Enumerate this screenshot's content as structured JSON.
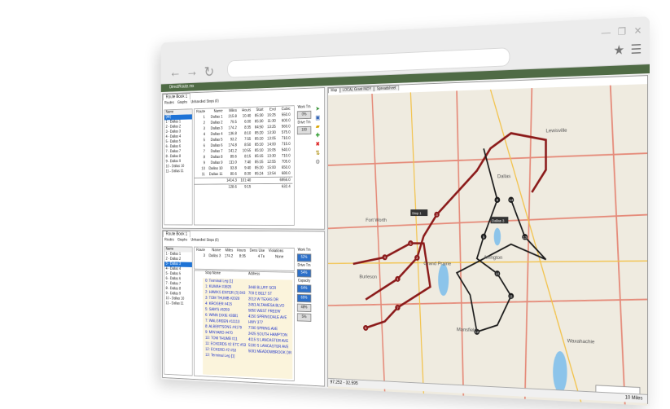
{
  "browser": {
    "back_icon": "arrow-left",
    "forward_icon": "arrow-right",
    "reload_icon": "reload",
    "star_icon": "star",
    "menu_icon": "hamburger"
  },
  "app": {
    "title": "DirectRoute.mx",
    "top_panel": {
      "tab": "Route Book 1",
      "subtabs": [
        "Routes",
        "Graphs",
        "Unhandled Stops (0)"
      ],
      "tree_header": "Name",
      "tree": [
        "(All)",
        "1 - Dallas 1",
        "2 - Dallas 2",
        "3 - Dallas 3",
        "4 - Dallas 4",
        "5 - Dallas 5",
        "6 - Dallas 6",
        "7 - Dallas 7",
        "8 - Dallas 8",
        "9 - Dallas 9",
        "10 - Dallas 10",
        "11 - Dallas 11"
      ],
      "columns": [
        "Route",
        "Name",
        "Miles",
        "Hours",
        "Start",
        "End",
        "Cubic"
      ],
      "rows": [
        [
          "1",
          "Dallas 1",
          "215.8",
          "10.40",
          "05:30",
          "16:25",
          "550.0"
        ],
        [
          "2",
          "Dallas 2",
          "79.5",
          "6:00",
          "05:30",
          "11:30",
          "600.0"
        ],
        [
          "3",
          "Dallas 3",
          "174.2",
          "8:35",
          "04:50",
          "13:25",
          "560.0"
        ],
        [
          "4",
          "Dallas 4",
          "136.8",
          "8:10",
          "05:20",
          "13:30",
          "575.0"
        ],
        [
          "5",
          "Dallas 5",
          "93.2",
          "7:55",
          "05:10",
          "13:05",
          "710.0"
        ],
        [
          "6",
          "Dallas 6",
          "174.8",
          "8:50",
          "05:10",
          "14:00",
          "715.0"
        ],
        [
          "7",
          "Dallas 7",
          "141.2",
          "10:55",
          "05:10",
          "16:05",
          "540.0"
        ],
        [
          "8",
          "Dallas 8",
          "89.6",
          "8:15",
          "05:15",
          "13:30",
          "710.0"
        ],
        [
          "9",
          "Dallas 9",
          "111.0",
          "7:40",
          "05:15",
          "12:55",
          "705.0"
        ],
        [
          "10",
          "Dallas 10",
          "93.8",
          "9:40",
          "05:20",
          "15:00",
          "650.0"
        ],
        [
          "11",
          "Dallas 11",
          "80.6",
          "8:30",
          "05:24",
          "13:54",
          "680.0"
        ]
      ],
      "totals": [
        "1414.3",
        "101:40",
        "",
        "",
        "6956.0"
      ],
      "avg": [
        "128.6",
        "9:15",
        "",
        "",
        "632.4"
      ],
      "side": {
        "work_label": "Work Tm",
        "work_value": "0%",
        "drive_label": "Drive Tm",
        "drive_value": "100"
      }
    },
    "bottom_panel": {
      "tab": "Route Book 1",
      "subtabs": [
        "Routes",
        "Graphs",
        "Unhandled Stops (0)"
      ],
      "search": "3 - Dallas 3",
      "tree_header": "Name",
      "tree": [
        "1 - Dallas 1",
        "2 - Dallas 2",
        "3 - Dallas 3",
        "4 - Dallas 4",
        "5 - Dallas 5",
        "6 - Dallas 6",
        "7 - Dallas 7",
        "8 - Dallas 8",
        "9 - Dallas 9",
        "10 - Dallas 10",
        "11 - Dallas 11"
      ],
      "summary_cols": [
        "Route",
        "Name",
        "Miles",
        "Hours",
        "Dens Use",
        "Violations"
      ],
      "summary_row": [
        "3",
        "Dallas 3",
        "174.2",
        "8:35",
        "4 Tn",
        "None"
      ],
      "stop_cols": [
        "Stop Name",
        "Address"
      ],
      "stops": [
        [
          "0: Terminal Leg [1]",
          ""
        ],
        [
          "1: KUMAH #3826",
          "3448 BLUFF SCR"
        ],
        [
          "2: HAWKS ENTER (3) 8#3",
          "700 E BELT ST"
        ],
        [
          "3: TOM THUMB #2020",
          "2013 W TEXAS DR"
        ],
        [
          "4: KROGER #415",
          "2451 ALTAMESA BLVD"
        ],
        [
          "5: SAM'S #6269",
          "5850 WEST FREEW"
        ],
        [
          "6: WINN DIXIE #2881",
          "4150 SPRINGDALE AVE"
        ],
        [
          "7: WALGREEN #11113",
          "HWY 377"
        ],
        [
          "8: ALBERTSONS #4179",
          "7700 SPRING AVE"
        ],
        [
          "9: MINYARD #470",
          "2425 SOUTH HAMPTON"
        ],
        [
          "10: TOM THUMB #11",
          "4115 S LANCASTER AVE"
        ],
        [
          "11: ECKERDS #2 ETC #53",
          "5100 S LANCASTER AVE"
        ],
        [
          "12: ECKERD #2 #53",
          "5001 MEADOWBROOK DR"
        ],
        [
          "13: Terminal Leg [1]",
          ""
        ]
      ],
      "side": {
        "work_label": "Work Tm",
        "work_value": "52%",
        "drive_label": "Drive Tm",
        "drive_value": "54%",
        "capacity_label": "Capacity",
        "capacity": [
          "64%",
          "65%",
          "48%",
          "5%"
        ]
      }
    },
    "map": {
      "tabs": [
        "Map",
        "LOCAL Grant INDY",
        "Spreadsheet"
      ],
      "labels": [
        "Arlington",
        "Grand Prairie",
        "Mansfield",
        "Waxahachie",
        "Burleson",
        "Lewisville",
        "Dallas",
        "Fort Worth"
      ],
      "callouts": [
        "Stop 1",
        "Dallas 3"
      ],
      "copyright": "HERE MS Copyright © 2016 DirectRoute",
      "status_coords": "97.252 - 32.595",
      "scale": "10 Miles",
      "route_color": "#8b1a1a",
      "route2_color": "#1a1a1a"
    }
  }
}
